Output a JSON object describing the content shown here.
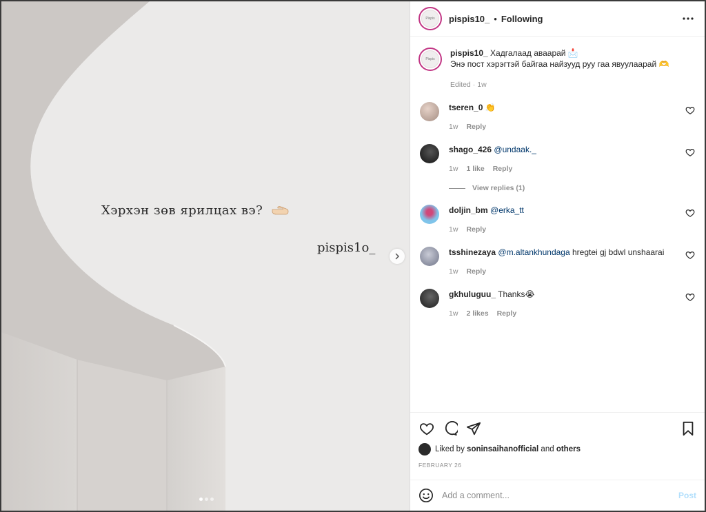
{
  "post": {
    "overlay_text": "Хэрхэн зөв ярилцах вэ?",
    "watermark": "pispis1o_",
    "slides": 3,
    "active_slide": 1
  },
  "header": {
    "username": "pispis10_",
    "separator": "•",
    "follow_label": "Following",
    "avatar_text": "Pispis"
  },
  "caption": {
    "username": "pispis10_",
    "line1": "Хадгалаад аваарай 📩",
    "line2": "Энэ пост хэрэгтэй байгаа найзууд руу гаа явуулаарай 🫶",
    "edited": "Edited",
    "dot": "·",
    "time": "1w"
  },
  "comments": [
    {
      "username": "tseren_0",
      "mention": "",
      "text": "👏",
      "time": "1w",
      "likes": "",
      "reply": "Reply",
      "avatar_color": "#b8a49a"
    },
    {
      "username": "shago_426",
      "mention": "@undaak._",
      "text": "",
      "time": "1w",
      "likes": "1 like",
      "reply": "Reply",
      "avatar_color": "#1c1c1c",
      "view_replies": "View replies (1)"
    },
    {
      "username": "doljin_bm",
      "mention": "@erka_tt",
      "text": "",
      "time": "1w",
      "likes": "",
      "reply": "Reply",
      "avatar_color": "#6ab6e0"
    },
    {
      "username": "tsshinezaya",
      "mention": "@m.altankhundaga",
      "text": " hregtei gj bdwl unshaarai",
      "time": "1w",
      "likes": "",
      "reply": "Reply",
      "avatar_color": "#9aa0b4"
    },
    {
      "username": "gkhuluguu_",
      "mention": "",
      "text": "Thanks😭",
      "time": "1w",
      "likes": "2 likes",
      "reply": "Reply",
      "avatar_color": "#262626"
    }
  ],
  "likes": {
    "prefix": "Liked by",
    "user": "soninsaihanofficial",
    "and": "and",
    "others": "others"
  },
  "date": "FEBRUARY 26",
  "add_comment": {
    "placeholder": "Add a comment...",
    "post_label": "Post"
  },
  "colors": {
    "accent_link": "#00376b",
    "post_disabled": "#b2dffc",
    "avatar_ring": "#c13584"
  }
}
